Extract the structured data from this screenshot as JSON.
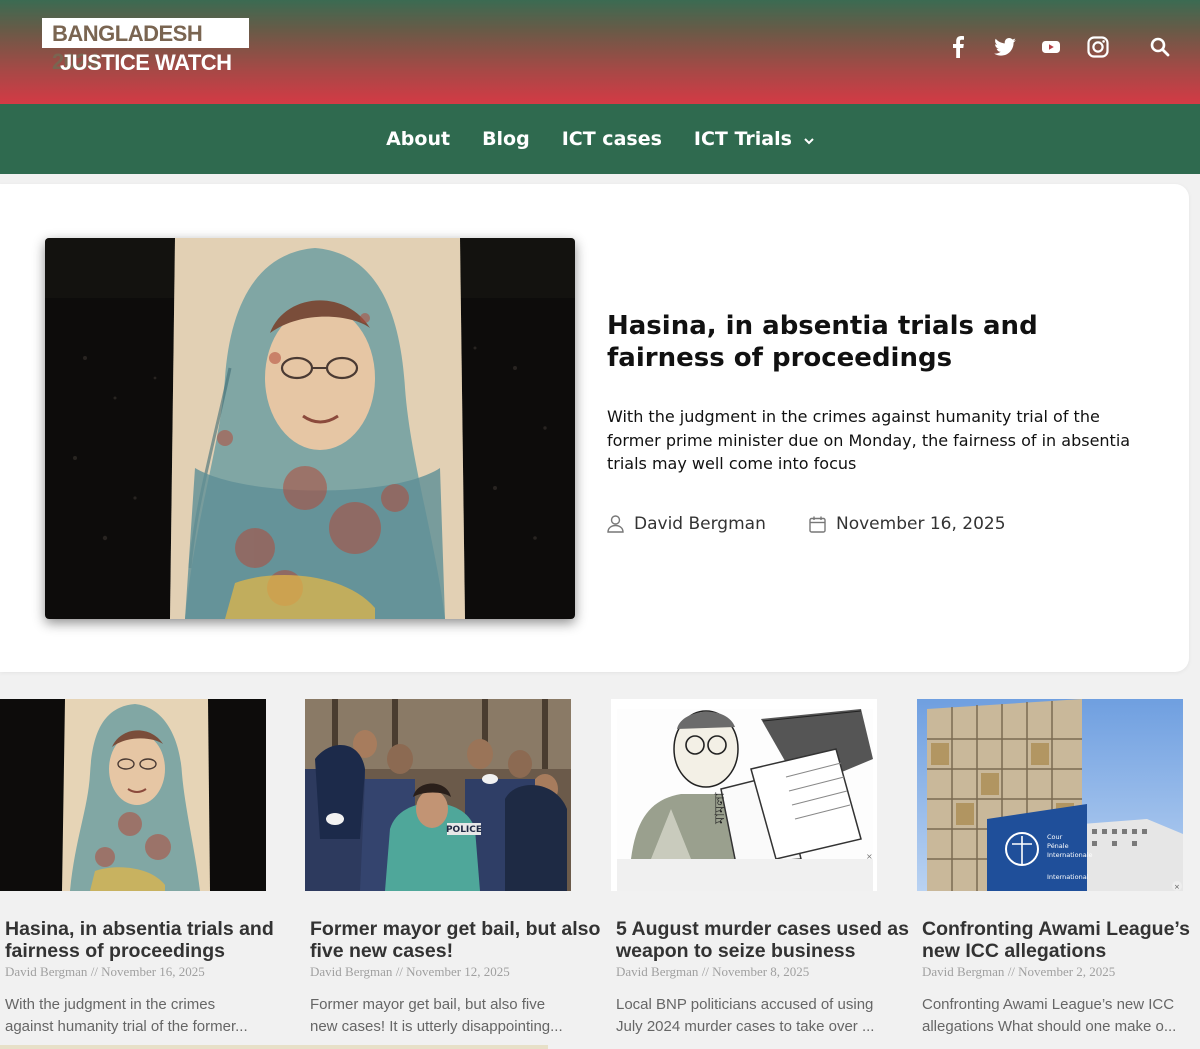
{
  "brand": {
    "line1": "BANGLADESH 2024",
    "line2": "JUSTICE WATCH"
  },
  "header": {
    "icons": [
      "facebook-icon",
      "twitter-icon",
      "youtube-icon",
      "instagram-icon",
      "search-icon"
    ]
  },
  "nav": {
    "items": [
      "About",
      "Blog",
      "ICT cases",
      "ICT Trials"
    ]
  },
  "featured": {
    "title": "Hasina, in absentia trials and fairness of proceedings",
    "excerpt": "With the judgment in the crimes against humanity trial of the former prime minister due on Monday, the fairness of in absentia trials may well come into focus",
    "author": "David Bergman",
    "date": "November 16, 2025"
  },
  "cards": [
    {
      "title": "Hasina, in absentia trials and fairness of proceedings",
      "author": "David Bergman",
      "date": "November 16, 2025",
      "excerpt_line1": "With the judgment in the crimes",
      "excerpt_line2": "against humanity trial of the former..."
    },
    {
      "title": "Former mayor get bail, but also five new cases!",
      "author": "David Bergman",
      "date": "November 12, 2025",
      "excerpt_line1": "Former mayor get bail, but also five",
      "excerpt_line2": "new cases! It is utterly disappointing..."
    },
    {
      "title": "5 August murder cases used as weapon to seize business",
      "author": "David Bergman",
      "date": "November 8, 2025",
      "excerpt_line1": "Local BNP politicians accused of using",
      "excerpt_line2": "July 2024 murder cases to take over ..."
    },
    {
      "title": "Confronting Awami League’s new ICC allegations",
      "author": "David Bergman",
      "date": "November 2, 2025",
      "excerpt_line1": "Confronting Awami League’s new ICC",
      "excerpt_line2": "allegations   What should one make o..."
    }
  ],
  "meta_separator": " // ",
  "images": {
    "card3_badge": "মামলা",
    "card4_sign_l1": "Cour",
    "card4_sign_l2": "Pénale",
    "card4_sign_l3": "Internationale",
    "card4_sign_l4": "International",
    "card2_badge": "POLICE"
  }
}
